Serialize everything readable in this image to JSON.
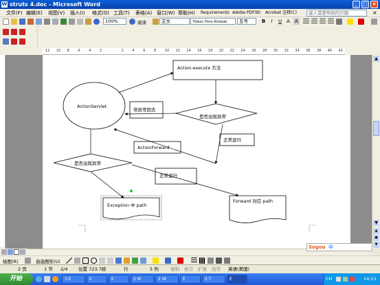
{
  "window": {
    "title": "struts 4.doc - Microsoft Word",
    "min": "_",
    "max": "□",
    "close": "×"
  },
  "menu": {
    "items": [
      "文件(F)",
      "编辑(E)",
      "视图(V)",
      "插入(I)",
      "格式(O)",
      "工具(T)",
      "表格(A)",
      "窗口(W)",
      "帮助(H)",
      "Requirements",
      "Adobe PDF(B)",
      "Acrobat 注释(C)"
    ],
    "help_placeholder": "键入需要帮助的问题",
    "close": "×"
  },
  "toolbar": {
    "zoom": "100%",
    "read_label": "阅读",
    "style": "正文",
    "font": "Times New Roman",
    "size": "五号",
    "bold": "B",
    "italic": "I",
    "underline": "U",
    "char_A": "A"
  },
  "ruler": {
    "ticks": [
      "12",
      "10",
      "8",
      "6",
      "4",
      "2",
      "",
      "2",
      "4",
      "6",
      "8",
      "10",
      "12",
      "14",
      "16",
      "18",
      "20",
      "22",
      "24",
      "26",
      "28",
      "30",
      "32",
      "34",
      "36",
      "38",
      "40",
      "42"
    ]
  },
  "diagram": {
    "action_execute": "Action.execute 方法",
    "action_servlet": "ActionServlet",
    "return_with_exception": "带异常回去",
    "has_exception_right": "是否出现异常",
    "normal_run_right": "正常运行",
    "action_forward": "ActionForward",
    "has_exception_left": "是否出现异常",
    "normal_run_mid": "正常运行",
    "exception_path": "Exception  中 path",
    "forward_path": "Forward 对应 path"
  },
  "drawbar": {
    "draw": "绘图(R)",
    "autoshapes": "自选图形(U)"
  },
  "status": {
    "page": "2 页",
    "section": "1 节",
    "pages": "2/4",
    "position": "位置 723.7磅",
    "line": "行",
    "col": "5 列",
    "rec": "录制",
    "trk": "修订",
    "ext": "扩展",
    "ovr": "改写",
    "lang": "英语(美国)"
  },
  "taskbar": {
    "start": "开始",
    "tasks": [
      "3 E",
      "E",
      "E",
      "2 M",
      "2 W",
      "E",
      "2 T",
      "E"
    ],
    "tray_lang": "CH",
    "time": "14:15"
  },
  "ime": {
    "name": "Sogou",
    "mode": "中"
  },
  "colors": {
    "title_blue": "#0842a8",
    "task_blue": "#3c81f0",
    "start_green": "#2f8a2f",
    "ellipse_stroke": "#000"
  }
}
